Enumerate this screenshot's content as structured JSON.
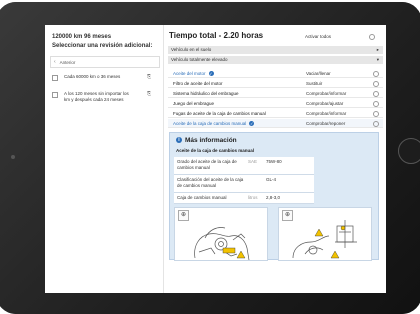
{
  "left": {
    "km_title": "120000 km 96 meses",
    "select_title": "Seleccionar una revisión adicional:",
    "previous_label": "Anterior",
    "options": [
      {
        "text": "Cada 60000 km o 36 meses"
      },
      {
        "text": "A los 120 meses sin importar los km y después cada 24 meses"
      }
    ]
  },
  "right": {
    "title": "Tiempo total - 2.20 horas",
    "activate_all_label": "Activar todos",
    "bars": [
      {
        "label": "Vehículo en el suelo",
        "arrow": "▸"
      },
      {
        "label": "Vehículo totalmente elevado",
        "arrow": "▾"
      }
    ],
    "tasks": [
      {
        "name": "Aceite del motor",
        "action": "Vaciar/llenar",
        "link": true,
        "info": true
      },
      {
        "name": "Filtro de aceite del motor",
        "action": "Sustituir",
        "link": false,
        "info": false
      },
      {
        "name": "Sistema hidráulico del embrague",
        "action": "Comprobar/informar",
        "link": false,
        "info": false
      },
      {
        "name": "Juego del embrague",
        "action": "Comprobar/ajustar",
        "link": false,
        "info": false
      },
      {
        "name": "Fugas de aceite de la caja de cambios manual",
        "action": "Comprobar/informar",
        "link": false,
        "info": false
      },
      {
        "name": "Aceite de la caja de cambios manual",
        "action": "Comprobar/reponer",
        "link": true,
        "info": true
      }
    ],
    "info_panel": {
      "header": "Más información",
      "subheader": "Aceite de la caja de cambios manual",
      "specs": [
        {
          "key": "Grado del aceite de la caja de cambios manual",
          "unit": "SAE",
          "value": "75W-80"
        },
        {
          "key": "Clasificación del aceite de la caja de cambios manual",
          "unit": "",
          "value": "GL-4"
        },
        {
          "key": "Caja de cambios manual",
          "unit": "litros",
          "value": "2,8-3,0"
        }
      ]
    }
  },
  "colors": {
    "link": "#2a6db8",
    "info_panel_bg": "#dce9f5",
    "bezel": "#2a2a2a"
  }
}
